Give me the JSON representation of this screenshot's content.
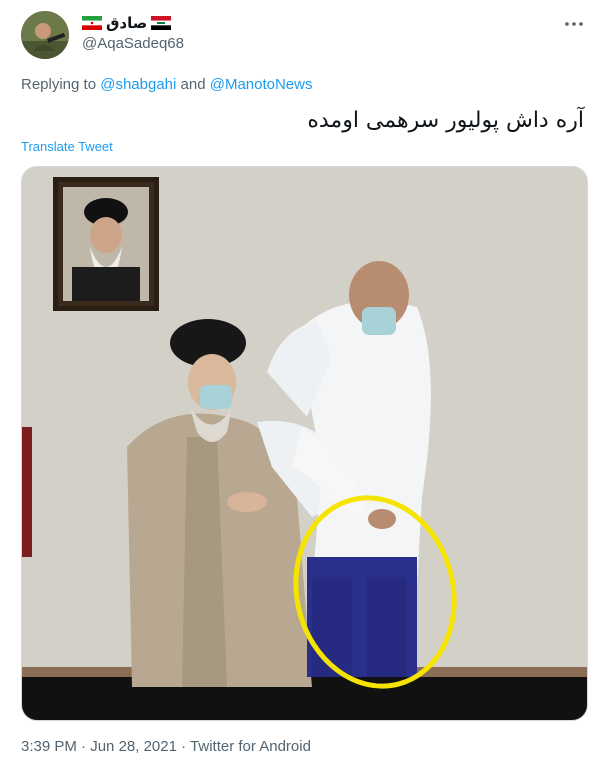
{
  "author": {
    "display_name": "صادق",
    "handle": "@AqaSadeq68"
  },
  "reply": {
    "prefix": "Replying to",
    "users": [
      "@shabgahi",
      "@ManotoNews"
    ],
    "joiner": "and"
  },
  "tweet_text": "آره داش پولیور سرهمی اومده",
  "translate_label": "Translate Tweet",
  "meta": {
    "time": "3:39 PM",
    "date": "Jun 28, 2021",
    "source": "Twitter for Android",
    "separator": "·"
  },
  "icons": {
    "more": "more-dots-icon",
    "flag_left": "iran-flag-icon",
    "flag_right": "iraq-flag-icon"
  },
  "colors": {
    "link": "#1d9bf0",
    "secondary": "#536471",
    "highlight_circle": "#f5e400"
  }
}
